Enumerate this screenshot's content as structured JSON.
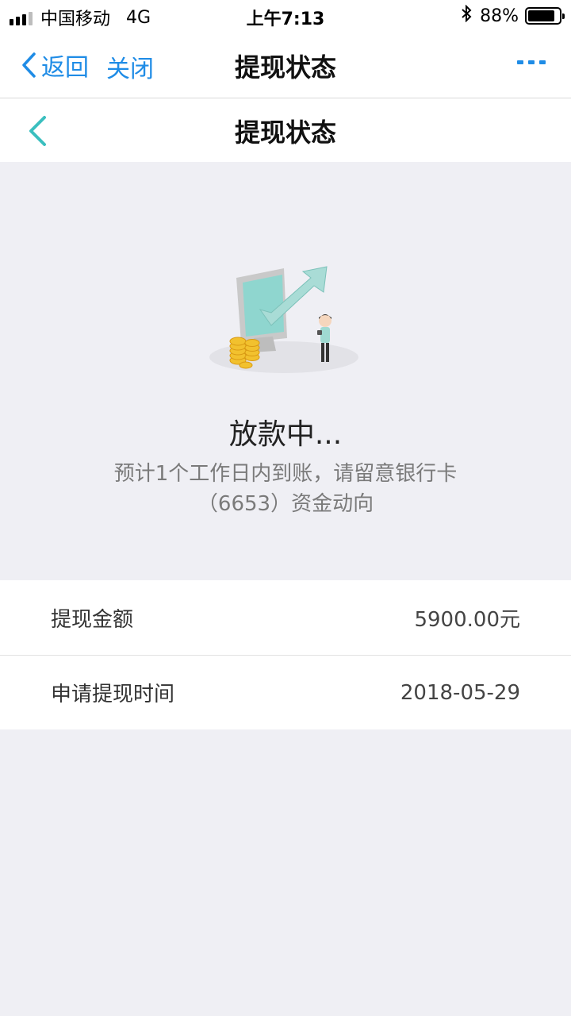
{
  "status_bar": {
    "carrier": "中国移动",
    "network": "4G",
    "time": "上午7:13",
    "battery_pct": "88%",
    "battery_level": 0.88
  },
  "outer_nav": {
    "back_label": "返回",
    "close_label": "关闭",
    "title": "提现状态",
    "more_icon": "more-icon",
    "accent_color": "#1f8ce6"
  },
  "inner_nav": {
    "title": "提现状态",
    "back_icon": "chevron-left-icon",
    "accent_color": "#3bbfbf"
  },
  "status": {
    "title": "放款中...",
    "desc_line1": "预计1个工作日内到账，请留意银行卡",
    "desc_line2": "（6653）资金动向"
  },
  "details": [
    {
      "label": "提现金额",
      "value": "5900.00元"
    },
    {
      "label": "申请提现时间",
      "value": "2018-05-29"
    }
  ]
}
